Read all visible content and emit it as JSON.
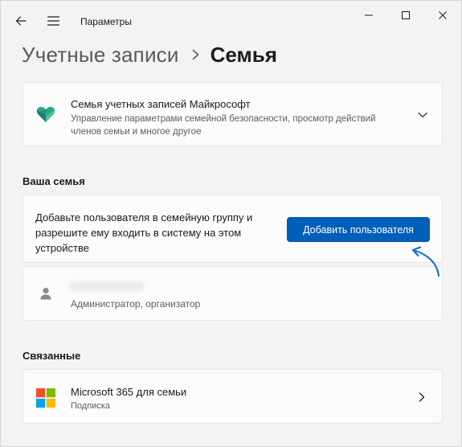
{
  "titlebar": {
    "app_title": "Параметры",
    "icons": {
      "back": "back-arrow-icon",
      "menu": "hamburger-icon",
      "minimize": "minimize-icon",
      "maximize": "maximize-icon",
      "close": "close-icon"
    }
  },
  "breadcrumb": {
    "parent": "Учетные записи",
    "separator_icon": "chevron-right-icon",
    "current": "Семья"
  },
  "microsoft_family": {
    "title": "Семья учетных записей Майкрософт",
    "description": "Управление параметрами семейной безопасности, просмотр действий членов семьи и многое другое",
    "icon": "family-heart-icon",
    "expand_icon": "chevron-down-icon"
  },
  "your_family": {
    "heading": "Ваша семья",
    "add_text": "Добавьте пользователя в семейную группу и разрешите ему входить в систему на этом устройстве",
    "add_button": "Добавить пользователя",
    "member": {
      "icon": "person-icon",
      "role": "Администратор, организатор"
    }
  },
  "related": {
    "heading": "Связанные",
    "items": [
      {
        "title": "Microsoft 365 для семьи",
        "subtitle": "Подписка",
        "icon": "microsoft-logo-icon",
        "chevron": "chevron-right-icon"
      }
    ]
  },
  "colors": {
    "accent": "#005fb8",
    "background": "#f3f3f3",
    "card": "#fbfbfb",
    "annotation_arrow": "#1a73c9"
  }
}
